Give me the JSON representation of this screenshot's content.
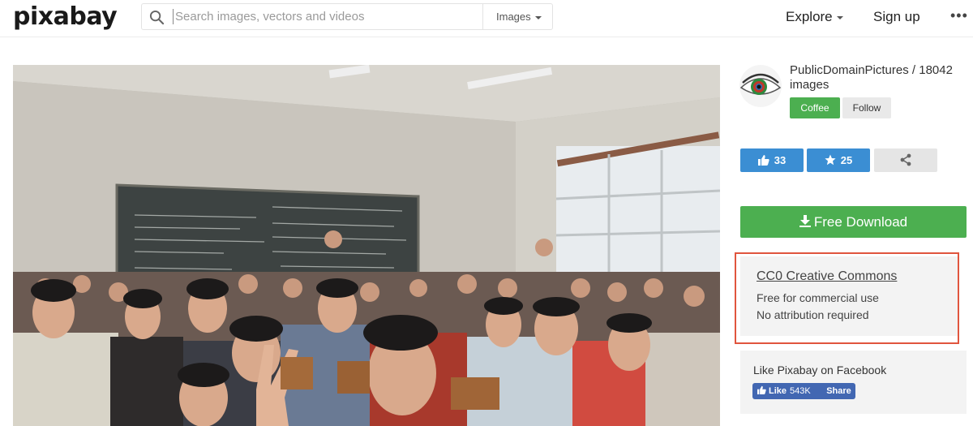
{
  "header": {
    "logo": "pixabay",
    "search_placeholder": "Search images, vectors and videos",
    "search_type": "Images",
    "nav": {
      "explore": "Explore",
      "signup": "Sign up",
      "more": "•••"
    }
  },
  "photo": {
    "subject": "classroom-students-photo"
  },
  "author": {
    "name_line": "PublicDomainPictures / 18042 images",
    "coffee_label": "Coffee",
    "follow_label": "Follow"
  },
  "actions": {
    "likes": "33",
    "favorites": "25"
  },
  "download": {
    "label": "Free Download"
  },
  "license": {
    "title": "CC0 Creative Commons",
    "line1": "Free for commercial use",
    "line2": "No attribution required"
  },
  "facebook": {
    "title": "Like Pixabay on Facebook",
    "like_label": "Like",
    "like_count": "543K",
    "share_label": "Share"
  },
  "colors": {
    "green": "#4caf50",
    "blue": "#3b8ed3",
    "highlight_frame": "#e0553e",
    "facebook": "#4267b2"
  }
}
